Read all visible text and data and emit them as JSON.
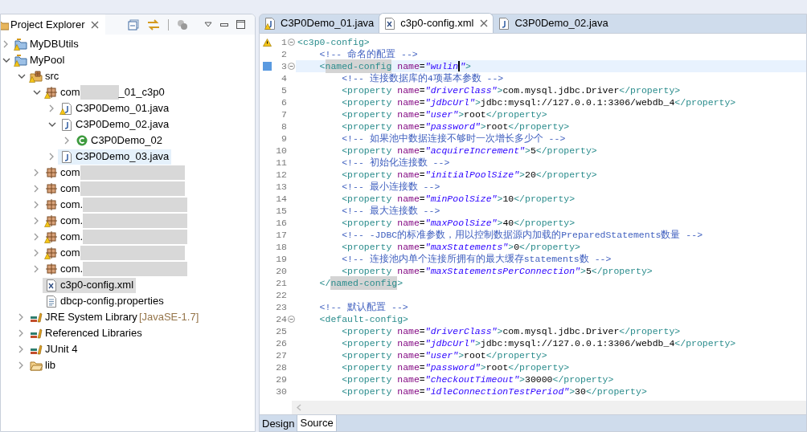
{
  "explorer": {
    "title": "Project Explorer",
    "tree": [
      {
        "label": "MyDBUtils",
        "kind": "project",
        "expanded": false,
        "warning": true,
        "selected": false,
        "hovered": false
      },
      {
        "label": "MyPool",
        "kind": "project",
        "expanded": true,
        "warning": true,
        "selected": false,
        "hovered": false,
        "children": [
          {
            "label": "src",
            "kind": "source-folder",
            "expanded": true,
            "warning": true,
            "selected": false,
            "hovered": false,
            "children": [
              {
                "label": "com",
                "label_after": "_01_c3p0",
                "redacted": true,
                "kind": "package",
                "expanded": true,
                "warning": true,
                "selected": false,
                "hovered": false,
                "children": [
                  {
                    "label": "C3P0Demo_01.java",
                    "kind": "java-file",
                    "expanded": false,
                    "warning": true,
                    "selected": false,
                    "hovered": false
                  },
                  {
                    "label": "C3P0Demo_02.java",
                    "kind": "java-file",
                    "expanded": true,
                    "warning": false,
                    "selected": false,
                    "hovered": false,
                    "children": [
                      {
                        "label": "C3P0Demo_02",
                        "kind": "class",
                        "expanded": false,
                        "warning": false,
                        "selected": false,
                        "hovered": false
                      }
                    ]
                  },
                  {
                    "label": "C3P0Demo_03.java",
                    "kind": "java-file",
                    "expanded": false,
                    "warning": false,
                    "selected": false,
                    "hovered": true
                  }
                ]
              },
              {
                "label": "com",
                "redacted": true,
                "kind": "package",
                "expanded": false,
                "warning": false,
                "selected": false,
                "hovered": false
              },
              {
                "label": "com",
                "redacted": true,
                "kind": "package",
                "expanded": false,
                "warning": false,
                "selected": false,
                "hovered": false
              },
              {
                "label": "com.",
                "redacted": true,
                "kind": "package",
                "expanded": false,
                "warning": false,
                "selected": false,
                "hovered": false
              },
              {
                "label": "com.",
                "redacted": true,
                "kind": "package",
                "expanded": false,
                "warning": true,
                "selected": false,
                "hovered": false
              },
              {
                "label": "com.",
                "redacted": true,
                "kind": "package",
                "expanded": false,
                "warning": true,
                "selected": false,
                "hovered": false
              },
              {
                "label": "com",
                "redacted": true,
                "kind": "package",
                "expanded": false,
                "warning": true,
                "selected": false,
                "hovered": false
              },
              {
                "label": "com.",
                "redacted": true,
                "kind": "package",
                "expanded": false,
                "warning": false,
                "selected": false,
                "hovered": false
              },
              {
                "label": "c3p0-config.xml",
                "kind": "xml-file",
                "warning": false,
                "selected": true,
                "hovered": false
              },
              {
                "label": "dbcp-config.properties",
                "kind": "properties-file",
                "warning": false,
                "selected": false,
                "hovered": false
              }
            ]
          },
          {
            "label": "JRE System Library",
            "decoration": "[JavaSE-1.7]",
            "kind": "library",
            "expanded": false,
            "warning": false,
            "selected": false,
            "hovered": false
          },
          {
            "label": "Referenced Libraries",
            "kind": "library",
            "expanded": false,
            "warning": false,
            "selected": false,
            "hovered": false
          },
          {
            "label": "JUnit 4",
            "kind": "library",
            "expanded": false,
            "warning": false,
            "selected": false,
            "hovered": false
          },
          {
            "label": "lib",
            "kind": "folder",
            "expanded": false,
            "warning": false,
            "selected": false,
            "hovered": false
          }
        ]
      }
    ]
  },
  "editor": {
    "tabs": [
      {
        "label": "C3P0Demo_01.java",
        "kind": "java",
        "warning": true,
        "selected": false
      },
      {
        "label": "c3p0-config.xml",
        "kind": "xml",
        "warning": false,
        "selected": true
      },
      {
        "label": "C3P0Demo_02.java",
        "kind": "java",
        "warning": false,
        "selected": false
      }
    ],
    "lines": [
      {
        "no": "1",
        "fold": true,
        "warning": true,
        "current": false,
        "tokens": [
          {
            "kind": "tag",
            "text": "<c3p0-config>"
          }
        ]
      },
      {
        "no": "2",
        "fold": false,
        "current": false,
        "tokens": [
          {
            "kind": "comment",
            "text": "    <!-- 命名的配置 -->"
          }
        ]
      },
      {
        "no": "3",
        "fold": true,
        "bookmark": true,
        "current": true,
        "tokens": [
          {
            "kind": "tag",
            "text": "    <"
          },
          {
            "kind": "mark",
            "text": "named-config"
          },
          {
            "kind": "attr",
            "text": " name"
          },
          {
            "kind": "text",
            "text": "="
          },
          {
            "kind": "caret-value",
            "text": "\"wulin"
          },
          {
            "kind": "value",
            "text": "\""
          },
          {
            "kind": "tag",
            "text": ">"
          }
        ]
      },
      {
        "no": "4",
        "fold": false,
        "current": false,
        "tokens": [
          {
            "kind": "comment",
            "text": "        <!-- 连接数据库的4项基本参数 -->"
          }
        ]
      },
      {
        "no": "5",
        "fold": false,
        "current": false,
        "tokens": [
          {
            "kind": "tag",
            "text": "        <property "
          },
          {
            "kind": "attr",
            "text": "name"
          },
          {
            "kind": "text",
            "text": "="
          },
          {
            "kind": "value",
            "text": "\"driverClass\""
          },
          {
            "kind": "tag",
            "text": ">"
          },
          {
            "kind": "text",
            "text": "com.mysql.jdbc.Driver"
          },
          {
            "kind": "tag",
            "text": "</property>"
          }
        ]
      },
      {
        "no": "6",
        "fold": false,
        "current": false,
        "tokens": [
          {
            "kind": "tag",
            "text": "        <property "
          },
          {
            "kind": "attr",
            "text": "name"
          },
          {
            "kind": "text",
            "text": "="
          },
          {
            "kind": "value",
            "text": "\"jdbcUrl\""
          },
          {
            "kind": "tag",
            "text": ">"
          },
          {
            "kind": "text",
            "text": "jdbc:mysql://127.0.0.1:3306/webdb_4"
          },
          {
            "kind": "tag",
            "text": "</property>"
          }
        ]
      },
      {
        "no": "7",
        "fold": false,
        "current": false,
        "tokens": [
          {
            "kind": "tag",
            "text": "        <property "
          },
          {
            "kind": "attr",
            "text": "name"
          },
          {
            "kind": "text",
            "text": "="
          },
          {
            "kind": "value",
            "text": "\"user\""
          },
          {
            "kind": "tag",
            "text": ">"
          },
          {
            "kind": "text",
            "text": "root"
          },
          {
            "kind": "tag",
            "text": "</property>"
          }
        ]
      },
      {
        "no": "8",
        "fold": false,
        "current": false,
        "tokens": [
          {
            "kind": "tag",
            "text": "        <property "
          },
          {
            "kind": "attr",
            "text": "name"
          },
          {
            "kind": "text",
            "text": "="
          },
          {
            "kind": "value",
            "text": "\"password\""
          },
          {
            "kind": "tag",
            "text": ">"
          },
          {
            "kind": "text",
            "text": "root"
          },
          {
            "kind": "tag",
            "text": "</property>"
          }
        ]
      },
      {
        "no": "9",
        "fold": false,
        "current": false,
        "tokens": [
          {
            "kind": "comment",
            "text": "        <!-- 如果池中数据连接不够时一次增长多少个 -->"
          }
        ]
      },
      {
        "no": "10",
        "fold": false,
        "current": false,
        "tokens": [
          {
            "kind": "tag",
            "text": "        <property "
          },
          {
            "kind": "attr",
            "text": "name"
          },
          {
            "kind": "text",
            "text": "="
          },
          {
            "kind": "value",
            "text": "\"acquireIncrement\""
          },
          {
            "kind": "tag",
            "text": ">"
          },
          {
            "kind": "text",
            "text": "5"
          },
          {
            "kind": "tag",
            "text": "</property>"
          }
        ]
      },
      {
        "no": "11",
        "fold": false,
        "current": false,
        "tokens": [
          {
            "kind": "comment",
            "text": "        <!-- 初始化连接数 -->"
          }
        ]
      },
      {
        "no": "12",
        "fold": false,
        "current": false,
        "tokens": [
          {
            "kind": "tag",
            "text": "        <property "
          },
          {
            "kind": "attr",
            "text": "name"
          },
          {
            "kind": "text",
            "text": "="
          },
          {
            "kind": "value",
            "text": "\"initialPoolSize\""
          },
          {
            "kind": "tag",
            "text": ">"
          },
          {
            "kind": "text",
            "text": "20"
          },
          {
            "kind": "tag",
            "text": "</property>"
          }
        ]
      },
      {
        "no": "13",
        "fold": false,
        "current": false,
        "tokens": [
          {
            "kind": "comment",
            "text": "        <!-- 最小连接数 -->"
          }
        ]
      },
      {
        "no": "14",
        "fold": false,
        "current": false,
        "tokens": [
          {
            "kind": "tag",
            "text": "        <property "
          },
          {
            "kind": "attr",
            "text": "name"
          },
          {
            "kind": "text",
            "text": "="
          },
          {
            "kind": "value",
            "text": "\"minPoolSize\""
          },
          {
            "kind": "tag",
            "text": ">"
          },
          {
            "kind": "text",
            "text": "10"
          },
          {
            "kind": "tag",
            "text": "</property>"
          }
        ]
      },
      {
        "no": "15",
        "fold": false,
        "current": false,
        "tokens": [
          {
            "kind": "comment",
            "text": "        <!-- 最大连接数 -->"
          }
        ]
      },
      {
        "no": "16",
        "fold": false,
        "current": false,
        "tokens": [
          {
            "kind": "tag",
            "text": "        <property "
          },
          {
            "kind": "attr",
            "text": "name"
          },
          {
            "kind": "text",
            "text": "="
          },
          {
            "kind": "value",
            "text": "\"maxPoolSize\""
          },
          {
            "kind": "tag",
            "text": ">"
          },
          {
            "kind": "text",
            "text": "40"
          },
          {
            "kind": "tag",
            "text": "</property>"
          }
        ]
      },
      {
        "no": "17",
        "fold": false,
        "current": false,
        "tokens": [
          {
            "kind": "comment",
            "text": "        <!-- -JDBC的标准参数，用以控制数据源内加载的PreparedStatements数量 -->"
          }
        ]
      },
      {
        "no": "18",
        "fold": false,
        "current": false,
        "tokens": [
          {
            "kind": "tag",
            "text": "        <property "
          },
          {
            "kind": "attr",
            "text": "name"
          },
          {
            "kind": "text",
            "text": "="
          },
          {
            "kind": "value",
            "text": "\"maxStatements\""
          },
          {
            "kind": "tag",
            "text": ">"
          },
          {
            "kind": "text",
            "text": "0"
          },
          {
            "kind": "tag",
            "text": "</property>"
          }
        ]
      },
      {
        "no": "19",
        "fold": false,
        "current": false,
        "tokens": [
          {
            "kind": "comment",
            "text": "        <!-- 连接池内单个连接所拥有的最大缓存statements数 -->"
          }
        ]
      },
      {
        "no": "20",
        "fold": false,
        "current": false,
        "tokens": [
          {
            "kind": "tag",
            "text": "        <property "
          },
          {
            "kind": "attr",
            "text": "name"
          },
          {
            "kind": "text",
            "text": "="
          },
          {
            "kind": "value",
            "text": "\"maxStatementsPerConnection\""
          },
          {
            "kind": "tag",
            "text": ">"
          },
          {
            "kind": "text",
            "text": "5"
          },
          {
            "kind": "tag",
            "text": "</property>"
          }
        ]
      },
      {
        "no": "21",
        "fold": false,
        "current": false,
        "tokens": [
          {
            "kind": "tag",
            "text": "    </"
          },
          {
            "kind": "mark",
            "text": "named-config"
          },
          {
            "kind": "tag",
            "text": ">"
          }
        ]
      },
      {
        "no": "22",
        "fold": false,
        "current": false
      },
      {
        "no": "23",
        "fold": false,
        "current": false,
        "tokens": [
          {
            "kind": "comment",
            "text": "    <!-- 默认配置 -->"
          }
        ]
      },
      {
        "no": "24",
        "fold": true,
        "current": false,
        "tokens": [
          {
            "kind": "tag",
            "text": "    <default-config>"
          }
        ]
      },
      {
        "no": "25",
        "fold": false,
        "current": false,
        "tokens": [
          {
            "kind": "tag",
            "text": "        <property "
          },
          {
            "kind": "attr",
            "text": "name"
          },
          {
            "kind": "text",
            "text": "="
          },
          {
            "kind": "value",
            "text": "\"driverClass\""
          },
          {
            "kind": "tag",
            "text": ">"
          },
          {
            "kind": "text",
            "text": "com.mysql.jdbc.Driver"
          },
          {
            "kind": "tag",
            "text": "</property>"
          }
        ]
      },
      {
        "no": "26",
        "fold": false,
        "current": false,
        "tokens": [
          {
            "kind": "tag",
            "text": "        <property "
          },
          {
            "kind": "attr",
            "text": "name"
          },
          {
            "kind": "text",
            "text": "="
          },
          {
            "kind": "value",
            "text": "\"jdbcUrl\""
          },
          {
            "kind": "tag",
            "text": ">"
          },
          {
            "kind": "text",
            "text": "jdbc:mysql://127.0.0.1:3306/webdb_4"
          },
          {
            "kind": "tag",
            "text": "</property>"
          }
        ]
      },
      {
        "no": "27",
        "fold": false,
        "current": false,
        "tokens": [
          {
            "kind": "tag",
            "text": "        <property "
          },
          {
            "kind": "attr",
            "text": "name"
          },
          {
            "kind": "text",
            "text": "="
          },
          {
            "kind": "value",
            "text": "\"user\""
          },
          {
            "kind": "tag",
            "text": ">"
          },
          {
            "kind": "text",
            "text": "root"
          },
          {
            "kind": "tag",
            "text": "</property>"
          }
        ]
      },
      {
        "no": "28",
        "fold": false,
        "current": false,
        "tokens": [
          {
            "kind": "tag",
            "text": "        <property "
          },
          {
            "kind": "attr",
            "text": "name"
          },
          {
            "kind": "text",
            "text": "="
          },
          {
            "kind": "value",
            "text": "\"password\""
          },
          {
            "kind": "tag",
            "text": ">"
          },
          {
            "kind": "text",
            "text": "root"
          },
          {
            "kind": "tag",
            "text": "</property>"
          }
        ]
      },
      {
        "no": "29",
        "fold": false,
        "current": false,
        "tokens": [
          {
            "kind": "tag",
            "text": "        <property "
          },
          {
            "kind": "attr",
            "text": "name"
          },
          {
            "kind": "text",
            "text": "="
          },
          {
            "kind": "value",
            "text": "\"checkoutTimeout\""
          },
          {
            "kind": "tag",
            "text": ">"
          },
          {
            "kind": "text",
            "text": "30000"
          },
          {
            "kind": "tag",
            "text": "</property>"
          }
        ]
      },
      {
        "no": "30",
        "fold": false,
        "current": false,
        "tokens": [
          {
            "kind": "tag",
            "text": "        <property "
          },
          {
            "kind": "attr",
            "text": "name"
          },
          {
            "kind": "text",
            "text": "="
          },
          {
            "kind": "value",
            "text": "\"idleConnectionTestPeriod\""
          },
          {
            "kind": "tag",
            "text": ">"
          },
          {
            "kind": "text",
            "text": "30"
          },
          {
            "kind": "tag",
            "text": "</property>"
          }
        ]
      }
    ],
    "bottom_tabs": [
      {
        "label": "Design",
        "selected": false
      },
      {
        "label": "Source",
        "selected": true
      }
    ]
  }
}
